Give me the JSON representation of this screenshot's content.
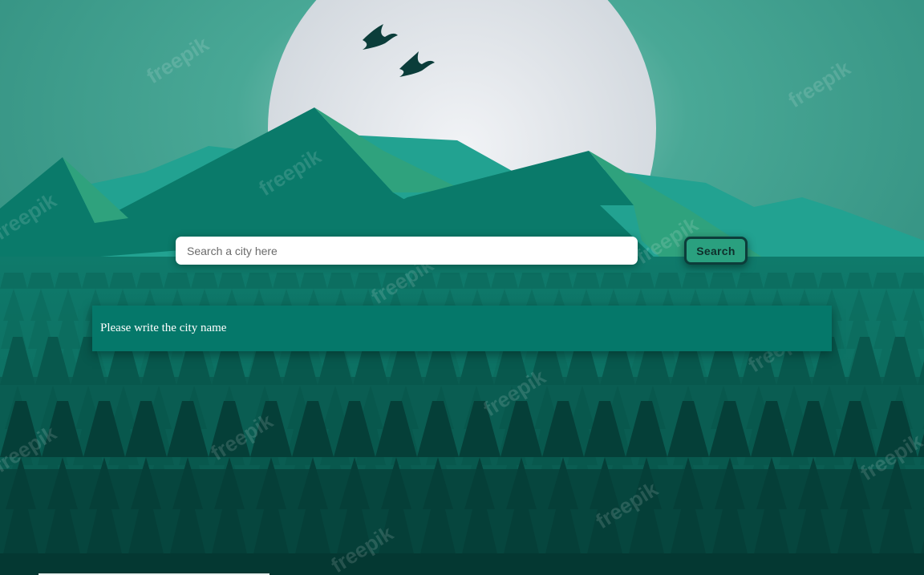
{
  "search": {
    "placeholder": "Search a city here",
    "value": "",
    "button_label": "Search"
  },
  "result": {
    "message": "Please write the city name"
  },
  "background": {
    "watermark_text": "freepik",
    "colors": {
      "sky": "#2e8b7c",
      "moon": "#e4e8ec",
      "mountain_light": "#22a291",
      "mountain_mid": "#0a7a6a",
      "mountain_highlight": "#2fa27d",
      "forest_far": "#0c6b5d",
      "forest_near": "#06443d",
      "button_border": "#0c3d3a",
      "button_fill": "#2aa07f",
      "panel": "#05786a"
    }
  }
}
